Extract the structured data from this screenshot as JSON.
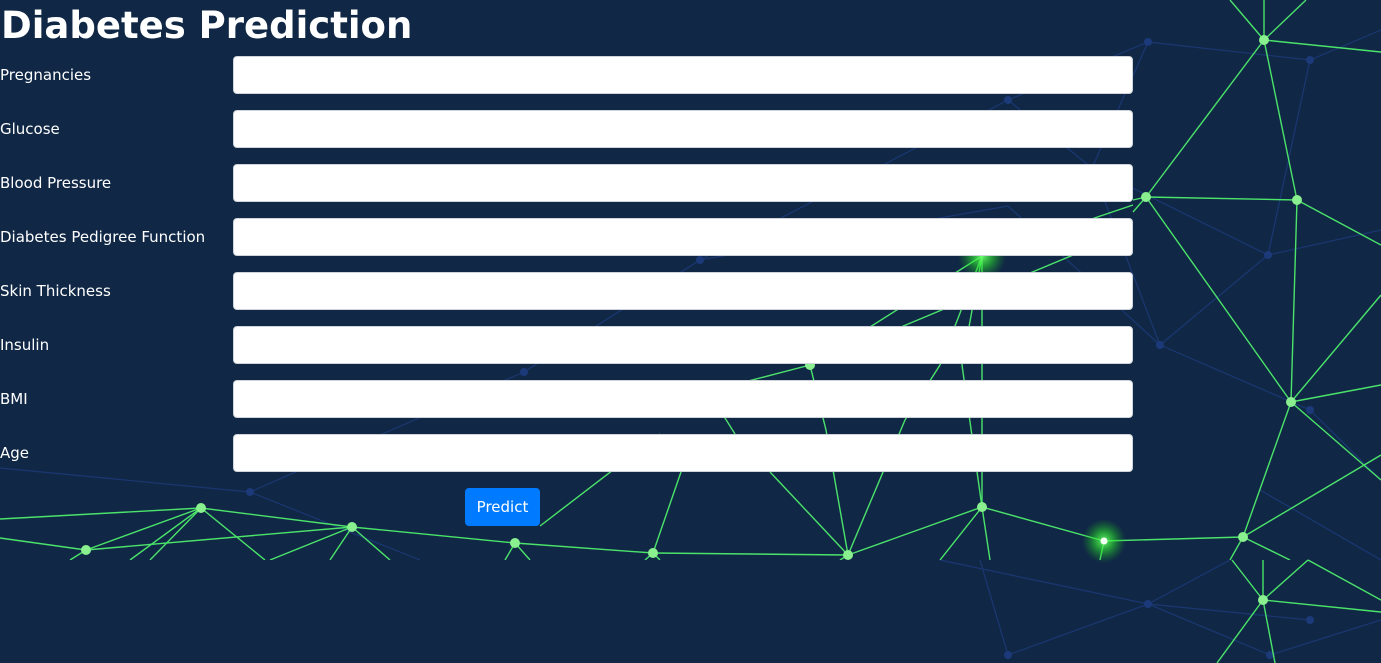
{
  "page": {
    "title": "Diabetes Prediction",
    "background_color": "#102846",
    "network_line_color": "#4be36a",
    "network_node_color": "#8af08f",
    "faint_line_color": "#1c3a7a"
  },
  "form": {
    "fields": [
      {
        "label": "Pregnancies",
        "value": "",
        "placeholder": ""
      },
      {
        "label": "Glucose",
        "value": "",
        "placeholder": ""
      },
      {
        "label": "Blood Pressure",
        "value": "",
        "placeholder": ""
      },
      {
        "label": "Diabetes Pedigree Function",
        "value": "",
        "placeholder": ""
      },
      {
        "label": "Skin Thickness",
        "value": "",
        "placeholder": ""
      },
      {
        "label": "Insulin",
        "value": "",
        "placeholder": ""
      },
      {
        "label": "BMI",
        "value": "",
        "placeholder": ""
      },
      {
        "label": "Age",
        "value": "",
        "placeholder": ""
      }
    ],
    "submit_label": "Predict",
    "submit_color": "#007bff"
  }
}
